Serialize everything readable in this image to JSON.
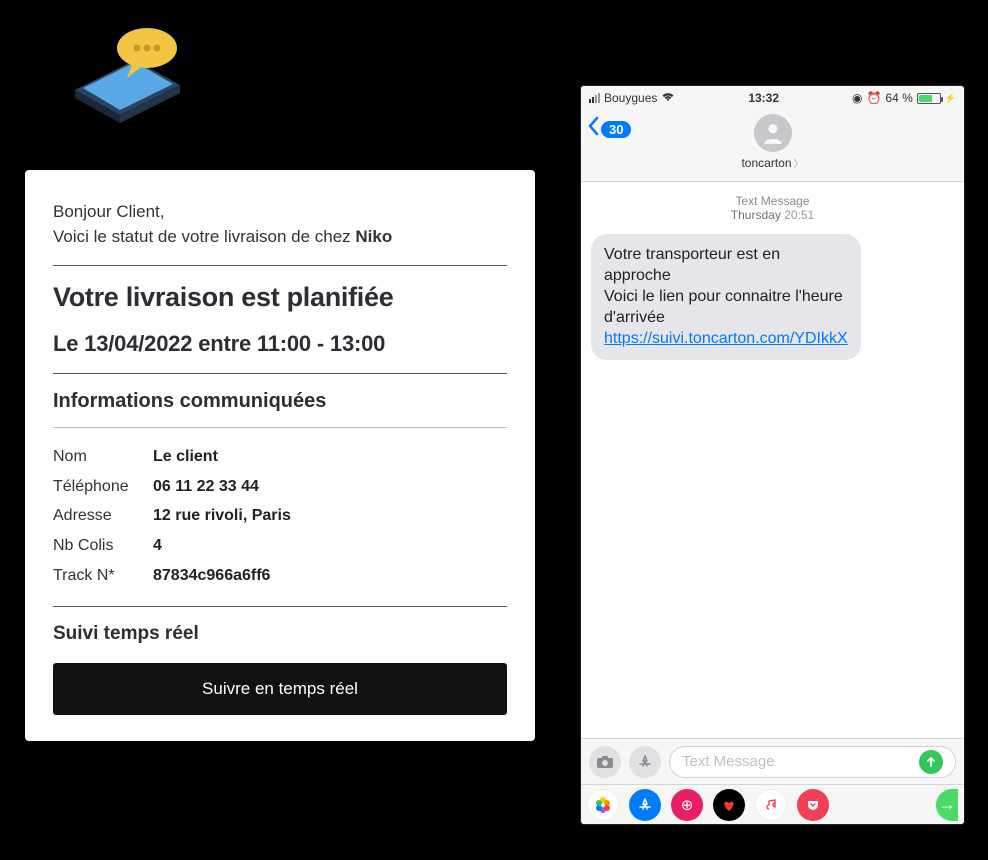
{
  "email": {
    "greeting_line1": "Bonjour Client,",
    "greeting_line2_prefix": "Voici le statut de votre livraison de chez ",
    "greeting_sender": "Niko",
    "status_title": "Votre livraison est planifiée",
    "status_date": "Le 13/04/2022 entre 11:00 - 13:00",
    "info_title": "Informations communiquées",
    "fields": {
      "name_label": "Nom",
      "name_value": "Le client",
      "phone_label": "Téléphone",
      "phone_value": "06 11 22 33 44",
      "address_label": "Adresse",
      "address_value": "12 rue rivoli, Paris",
      "packages_label": "Nb Colis",
      "packages_value": "4",
      "tracking_label": "Track N*",
      "tracking_value": "87834c966a6ff6"
    },
    "realtime_title": "Suivi temps réel",
    "follow_button": "Suivre en temps réel"
  },
  "phone": {
    "status": {
      "carrier": "Bouygues",
      "time": "13:32",
      "battery_pct": "64 %"
    },
    "nav": {
      "back_count": "30",
      "contact_name": "toncarton"
    },
    "thread": {
      "meta_label": "Text Message",
      "meta_day": "Thursday",
      "meta_time": "20:51",
      "sms_line1": "Votre transporteur est en approche",
      "sms_line2": "Voici le lien pour connaitre l'heure d'arrivée",
      "sms_link": "https://suivi.toncarton.com/YDIkkX"
    },
    "input": {
      "placeholder": "Text Message"
    }
  }
}
